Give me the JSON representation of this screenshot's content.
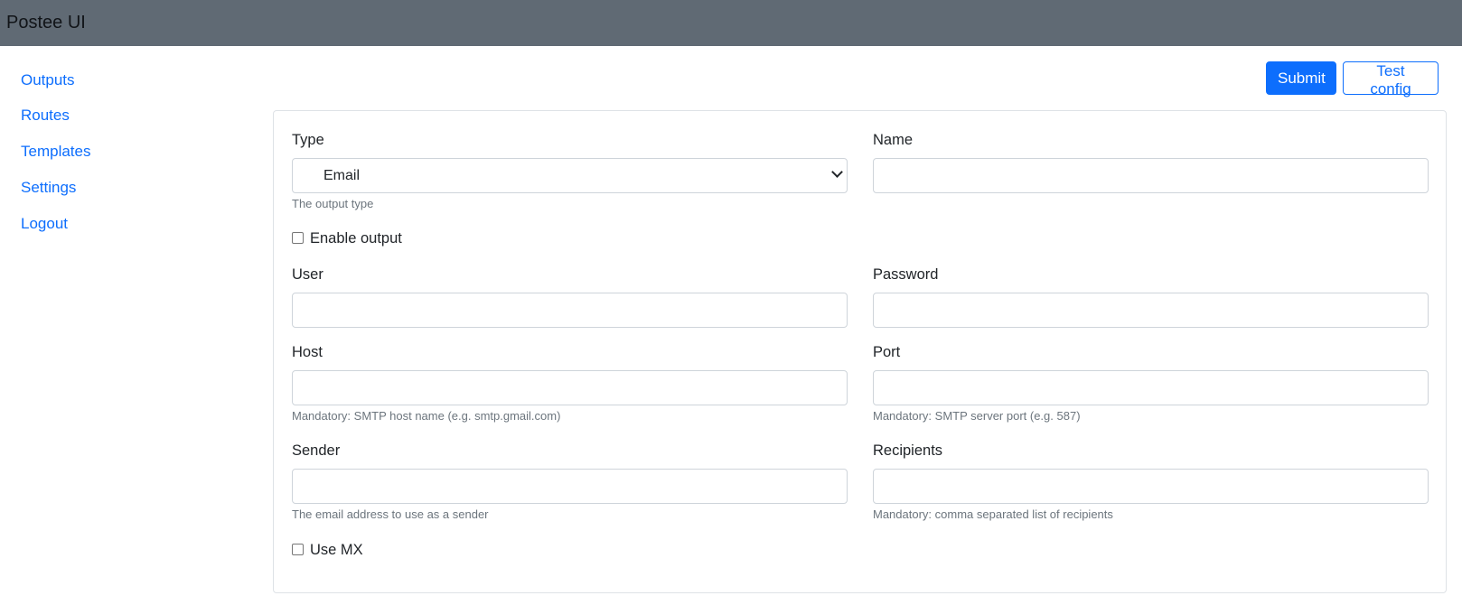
{
  "app": {
    "title": "Postee UI"
  },
  "sidebar": {
    "items": [
      {
        "label": "Outputs"
      },
      {
        "label": "Routes"
      },
      {
        "label": "Templates"
      },
      {
        "label": "Settings"
      },
      {
        "label": "Logout"
      }
    ]
  },
  "toolbar": {
    "submit_label": "Submit",
    "test_label": "Test config"
  },
  "form": {
    "type": {
      "label": "Type",
      "value": "Email",
      "help": "The output type"
    },
    "name": {
      "label": "Name",
      "value": ""
    },
    "enable_output": {
      "label": "Enable output",
      "checked": false
    },
    "user": {
      "label": "User",
      "value": ""
    },
    "password": {
      "label": "Password",
      "value": ""
    },
    "host": {
      "label": "Host",
      "value": "",
      "help": "Mandatory: SMTP host name (e.g. smtp.gmail.com)"
    },
    "port": {
      "label": "Port",
      "value": "",
      "help": "Mandatory: SMTP server port (e.g. 587)"
    },
    "sender": {
      "label": "Sender",
      "value": "",
      "help": "The email address to use as a sender"
    },
    "recipients": {
      "label": "Recipients",
      "value": "",
      "help": "Mandatory: comma separated list of recipients"
    },
    "use_mx": {
      "label": "Use MX",
      "checked": false
    }
  },
  "colors": {
    "navbar": "#606a74",
    "link": "#0d6efd",
    "primary": "#0d6efd",
    "help_text": "#6c757d"
  }
}
